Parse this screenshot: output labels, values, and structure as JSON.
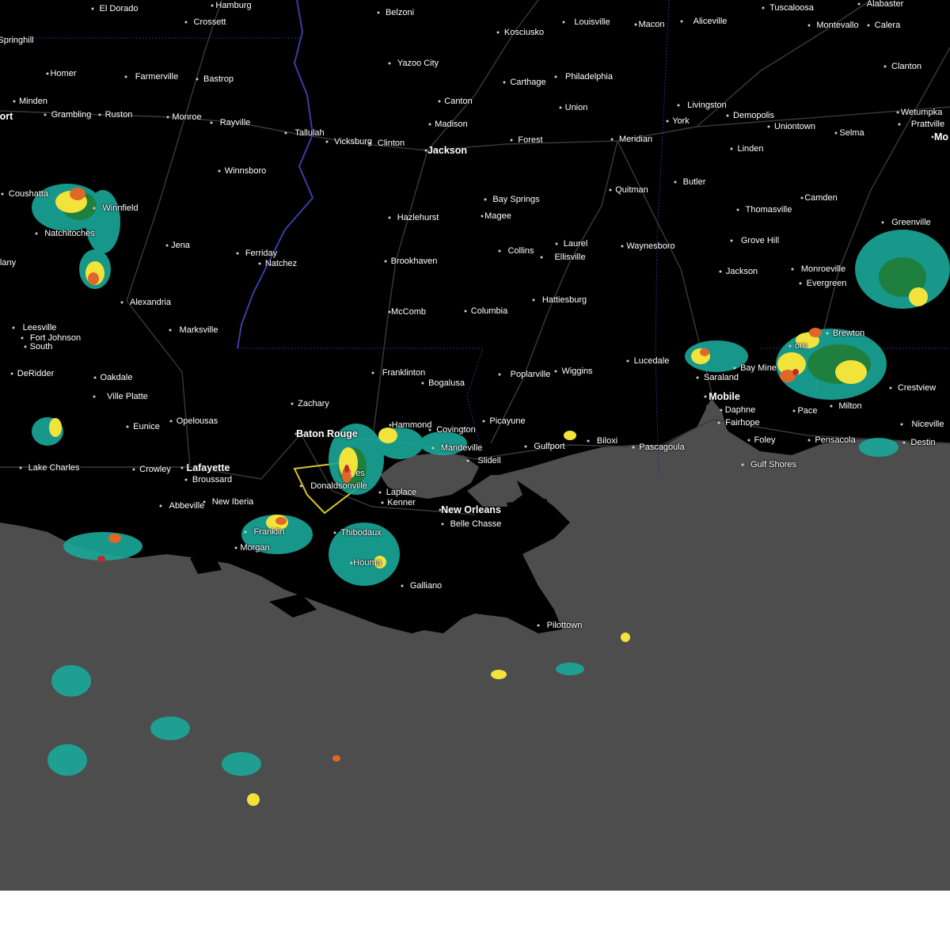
{
  "map": {
    "colors": {
      "land": "#000000",
      "water": "#4d4d4d",
      "roads": "#3a3a3a",
      "state_border": "#2b2b8f",
      "river": "#3c3ca8",
      "warning_polygon": "#d9c62a",
      "radar_light": "#19a89a",
      "radar_moderate": "#1f7f3f",
      "radar_heavy": "#f2e33c",
      "radar_intense": "#e0672a",
      "radar_extreme": "#c1272d"
    },
    "cities": [
      {
        "id": "el-dorado",
        "label": "El Dorado"
      },
      {
        "id": "hamburg",
        "label": "Hamburg"
      },
      {
        "id": "belzoni",
        "label": "Belzoni"
      },
      {
        "id": "louisville",
        "label": "Louisville"
      },
      {
        "id": "macon",
        "label": "Macon"
      },
      {
        "id": "aliceville",
        "label": "Aliceville"
      },
      {
        "id": "tuscaloosa",
        "label": "Tuscaloosa"
      },
      {
        "id": "alabaster",
        "label": "Alabaster"
      },
      {
        "id": "crossett",
        "label": "Crossett"
      },
      {
        "id": "kosciusko",
        "label": "Kosciusko"
      },
      {
        "id": "montevallo",
        "label": "Montevallo"
      },
      {
        "id": "calera",
        "label": "Calera"
      },
      {
        "id": "springhill",
        "label": "Springhill"
      },
      {
        "id": "yazoo-city",
        "label": "Yazoo City"
      },
      {
        "id": "clanton",
        "label": "Clanton"
      },
      {
        "id": "homer",
        "label": "Homer"
      },
      {
        "id": "farmerville",
        "label": "Farmerville"
      },
      {
        "id": "bastrop",
        "label": "Bastrop"
      },
      {
        "id": "carthage",
        "label": "Carthage"
      },
      {
        "id": "philadelphia",
        "label": "Philadelphia"
      },
      {
        "id": "minden",
        "label": "Minden"
      },
      {
        "id": "canton",
        "label": "Canton"
      },
      {
        "id": "union",
        "label": "Union"
      },
      {
        "id": "livingston",
        "label": "Livingston"
      },
      {
        "id": "wetumpka",
        "label": "Wetumpka"
      },
      {
        "id": "grambling",
        "label": "Grambling"
      },
      {
        "id": "ruston",
        "label": "Ruston"
      },
      {
        "id": "monroe",
        "label": "Monroe"
      },
      {
        "id": "demopolis",
        "label": "Demopolis"
      },
      {
        "id": "prattville",
        "label": "Prattville"
      },
      {
        "id": "york",
        "label": "York"
      },
      {
        "id": "uniontown",
        "label": "Uniontown"
      },
      {
        "id": "shreveport-partial",
        "label": "ort"
      },
      {
        "id": "rayville",
        "label": "Rayville"
      },
      {
        "id": "madison",
        "label": "Madison"
      },
      {
        "id": "tallulah",
        "label": "Tallulah"
      },
      {
        "id": "vicksburg",
        "label": "Vicksburg"
      },
      {
        "id": "clinton",
        "label": "Clinton"
      },
      {
        "id": "jackson-ms",
        "label": "Jackson"
      },
      {
        "id": "forest",
        "label": "Forest"
      },
      {
        "id": "meridian",
        "label": "Meridian"
      },
      {
        "id": "selma",
        "label": "Selma"
      },
      {
        "id": "montgomery-partial",
        "label": "Mo"
      },
      {
        "id": "linden",
        "label": "Linden"
      },
      {
        "id": "winnsboro",
        "label": "Winnsboro"
      },
      {
        "id": "butler",
        "label": "Butler"
      },
      {
        "id": "quitman",
        "label": "Quitman"
      },
      {
        "id": "bay-springs",
        "label": "Bay Springs"
      },
      {
        "id": "coushatta",
        "label": "Coushatta"
      },
      {
        "id": "camden",
        "label": "Camden"
      },
      {
        "id": "thomasville",
        "label": "Thomasville"
      },
      {
        "id": "magee",
        "label": "Magee"
      },
      {
        "id": "hazlehurst",
        "label": "Hazlehurst"
      },
      {
        "id": "winnfield",
        "label": "Winnfield"
      },
      {
        "id": "greenville",
        "label": "Greenville"
      },
      {
        "id": "natchitoches",
        "label": "Natchitoches"
      },
      {
        "id": "grove-hill",
        "label": "Grove Hill"
      },
      {
        "id": "laurel",
        "label": "Laurel"
      },
      {
        "id": "jena",
        "label": "Jena"
      },
      {
        "id": "waynesboro",
        "label": "Waynesboro"
      },
      {
        "id": "collins",
        "label": "Collins"
      },
      {
        "id": "ferriday",
        "label": "Ferriday"
      },
      {
        "id": "ellisville",
        "label": "Ellisville"
      },
      {
        "id": "brookhaven",
        "label": "Brookhaven"
      },
      {
        "id": "natchez",
        "label": "Natchez"
      },
      {
        "id": "many-partial",
        "label": "lany"
      },
      {
        "id": "monroeville",
        "label": "Monroeville"
      },
      {
        "id": "jackson-al",
        "label": "Jackson"
      },
      {
        "id": "evergreen",
        "label": "Evergreen"
      },
      {
        "id": "alexandria",
        "label": "Alexandria"
      },
      {
        "id": "hattiesburg",
        "label": "Hattiesburg"
      },
      {
        "id": "mccomb",
        "label": "McComb"
      },
      {
        "id": "columbia",
        "label": "Columbia"
      },
      {
        "id": "leesville",
        "label": "Leesville"
      },
      {
        "id": "marksville",
        "label": "Marksville"
      },
      {
        "id": "brewton",
        "label": "Brewton"
      },
      {
        "id": "fort-johnson",
        "label": "Fort Johnson"
      },
      {
        "id": "fort-johnson-south",
        "label": "South"
      },
      {
        "id": "atmore-partial",
        "label": "ore"
      },
      {
        "id": "lucedale",
        "label": "Lucedale"
      },
      {
        "id": "franklinton",
        "label": "Franklinton"
      },
      {
        "id": "deridder",
        "label": "DeRidder"
      },
      {
        "id": "wiggins",
        "label": "Wiggins"
      },
      {
        "id": "poplarville",
        "label": "Poplarville"
      },
      {
        "id": "oakdale",
        "label": "Oakdale"
      },
      {
        "id": "bay-minette",
        "label": "Bay Mine"
      },
      {
        "id": "bogalusa",
        "label": "Bogalusa"
      },
      {
        "id": "saraland",
        "label": "Saraland"
      },
      {
        "id": "crestview",
        "label": "Crestview"
      },
      {
        "id": "ville-platte",
        "label": "Ville Platte"
      },
      {
        "id": "mobile",
        "label": "Mobile"
      },
      {
        "id": "zachary",
        "label": "Zachary"
      },
      {
        "id": "milton",
        "label": "Milton"
      },
      {
        "id": "daphne",
        "label": "Daphne"
      },
      {
        "id": "pace",
        "label": "Pace"
      },
      {
        "id": "opelousas",
        "label": "Opelousas"
      },
      {
        "id": "picayune",
        "label": "Picayune"
      },
      {
        "id": "fairhope",
        "label": "Fairhope"
      },
      {
        "id": "hammond",
        "label": "Hammond"
      },
      {
        "id": "eunice",
        "label": "Eunice"
      },
      {
        "id": "covington",
        "label": "Covington"
      },
      {
        "id": "baton-rouge",
        "label": "Baton Rouge"
      },
      {
        "id": "niceville",
        "label": "Niceville"
      },
      {
        "id": "pensacola",
        "label": "Pensacola"
      },
      {
        "id": "foley",
        "label": "Foley"
      },
      {
        "id": "destin",
        "label": "Destin"
      },
      {
        "id": "mandeville",
        "label": "Mandeville"
      },
      {
        "id": "biloxi",
        "label": "Biloxi"
      },
      {
        "id": "gulfport",
        "label": "Gulfport"
      },
      {
        "id": "pascagoula",
        "label": "Pascagoula"
      },
      {
        "id": "slidell",
        "label": "Slidell"
      },
      {
        "id": "gulf-shores",
        "label": "Gulf Shores"
      },
      {
        "id": "lake-charles",
        "label": "Lake Charles"
      },
      {
        "id": "crowley",
        "label": "Crowley"
      },
      {
        "id": "lafayette",
        "label": "Lafayette"
      },
      {
        "id": "broussard",
        "label": "Broussard"
      },
      {
        "id": "gonzales-partial",
        "label": "es"
      },
      {
        "id": "donaldsonville",
        "label": "Donaldsonville"
      },
      {
        "id": "laplace",
        "label": "Laplace"
      },
      {
        "id": "new-iberia",
        "label": "New Iberia"
      },
      {
        "id": "kenner",
        "label": "Kenner"
      },
      {
        "id": "abbeville",
        "label": "Abbeville"
      },
      {
        "id": "new-orleans",
        "label": "New Orleans"
      },
      {
        "id": "belle-chasse",
        "label": "Belle Chasse"
      },
      {
        "id": "franklin",
        "label": "Franklin"
      },
      {
        "id": "thibodaux",
        "label": "Thibodaux"
      },
      {
        "id": "morgan-city",
        "label": "Morgan"
      },
      {
        "id": "houma",
        "label": "Houma"
      },
      {
        "id": "galliano",
        "label": "Galliano"
      },
      {
        "id": "pilottown",
        "label": "Pilottown"
      }
    ]
  }
}
